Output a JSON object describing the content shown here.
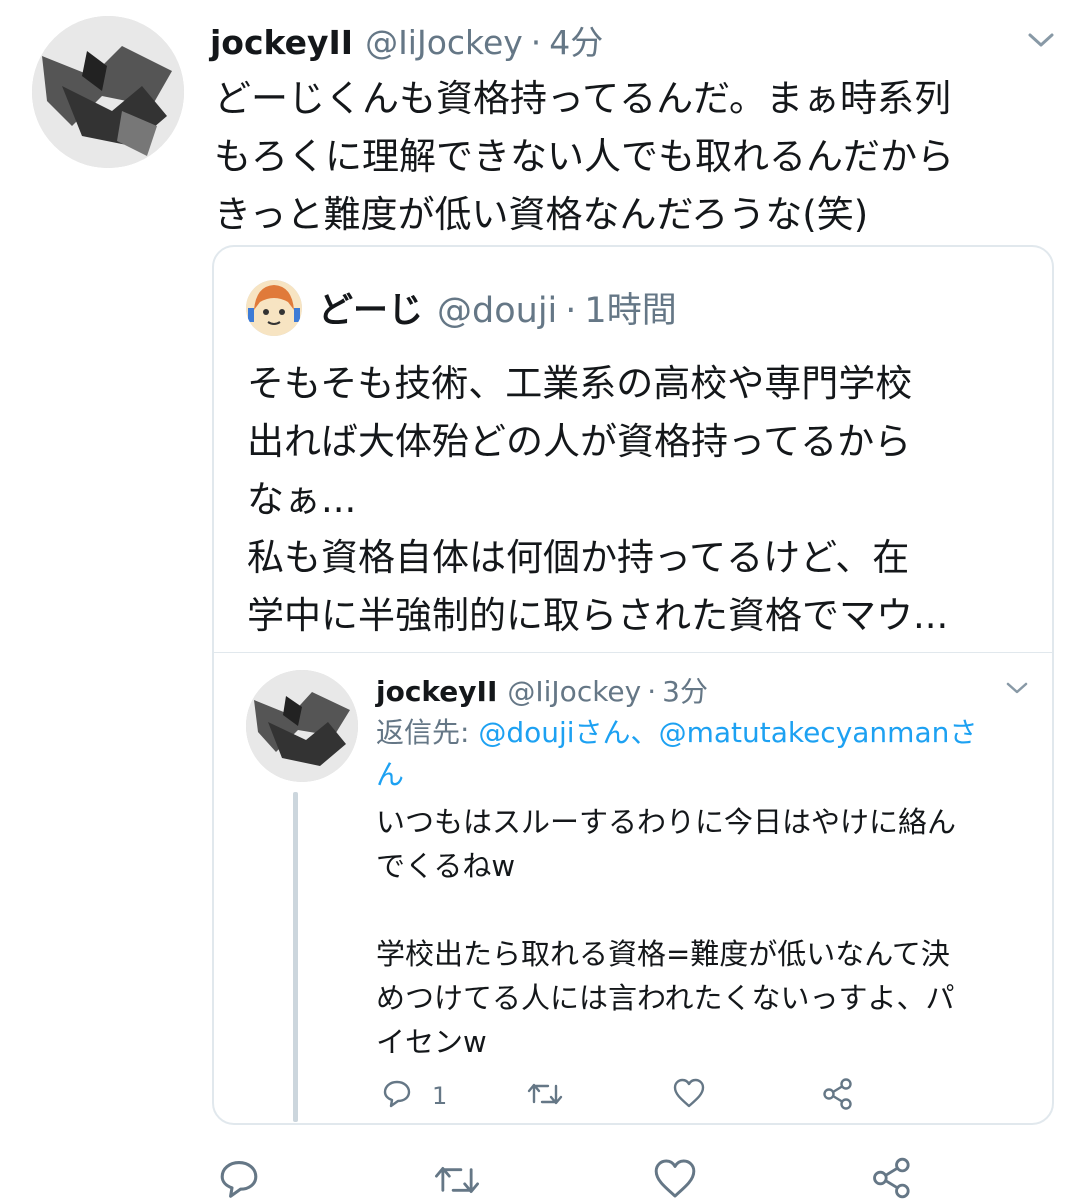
{
  "main_tweet": {
    "display_name": "jockeyII",
    "handle": "@IiJockey",
    "time": "4分",
    "text": "どーじくんも資格持ってるんだ。まぁ時系列\nもろくに理解できない人でも取れるんだから\nきっと難度が低い資格なんだろうな(笑)"
  },
  "quoted_tweet": {
    "display_name": "どーじ",
    "handle": "@douji",
    "time": "1時間",
    "text": "そもそも技術、工業系の高校や専門学校\n出れば大体殆どの人が資格持ってるから\nなぁ...\n私も資格自体は何個か持ってるけど、在\n学中に半強制的に取らされた資格でマウ..."
  },
  "reply_tweet": {
    "display_name": "jockeyII",
    "handle": "@IiJockey",
    "time": "3分",
    "reply_prefix": "返信先: ",
    "reply_to_1": "@doujiさん、",
    "reply_to_2": "@matutakecyanmanさ",
    "reply_to_3": "ん",
    "text": "いつもはスルーするわりに今日はやけに絡ん\nでくるねw\n\n学校出たら取れる資格=難度が低いなんて決\nめつけてる人には言われたくないっすよ、パ\nイセンw",
    "reply_count": "1"
  },
  "icons": [
    "chevron-down-icon",
    "reply-icon",
    "retweet-icon",
    "like-icon",
    "share-icon"
  ],
  "colors": {
    "link": "#1da1f2",
    "muted": "#657786",
    "border": "#e1e8ed",
    "thread_line": "#ccd6dd"
  }
}
